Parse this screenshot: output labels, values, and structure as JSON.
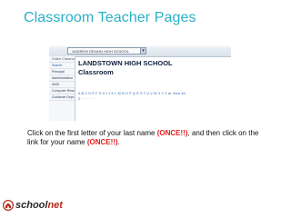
{
  "slide": {
    "title": "Classroom Teacher Pages"
  },
  "screenshot": {
    "dropdown_value": "· ANDREW DEVAIN HIGH SCHOOL",
    "dropdown_arrow": "▾",
    "sidebar": {
      "items": [
        {
          "label": "Online Classroom",
          "kind": "head"
        },
        {
          "label": "Search",
          "kind": "search"
        },
        {
          "label": "Principal",
          "kind": "item"
        },
        {
          "label": "Administration",
          "kind": "item"
        },
        {
          "label": "AVID",
          "kind": "item"
        },
        {
          "label": "Computer Resources",
          "kind": "item"
        },
        {
          "label": "Guidance Dept.",
          "kind": "item"
        }
      ]
    },
    "school_name": "LANDSTOWN HIGH SCHOOL",
    "school_subtitle": "Classroom",
    "alphabet_letters": "A B C D E F G H I J K L M N O P Q R S T U V W X Y Z",
    "alphabet_or": "or",
    "view_all_link": "View All",
    "alphabet_row2": "Z · · · · · · ·"
  },
  "instructions": {
    "part1": "Click on the first letter of your last name ",
    "emph1": "(ONCE!!)",
    "part2": ", and then click on the link for your name ",
    "emph2": "(ONCE!!)",
    "part3": "."
  },
  "logo": {
    "brand": "school",
    "brand_suffix": "net",
    "icon": "schoolnet-house-logo-icon"
  },
  "colors": {
    "title": "#2ab0c8",
    "emphasis": "#e02020",
    "link": "#2a5fb8",
    "logo_accent": "#b22a1a"
  }
}
